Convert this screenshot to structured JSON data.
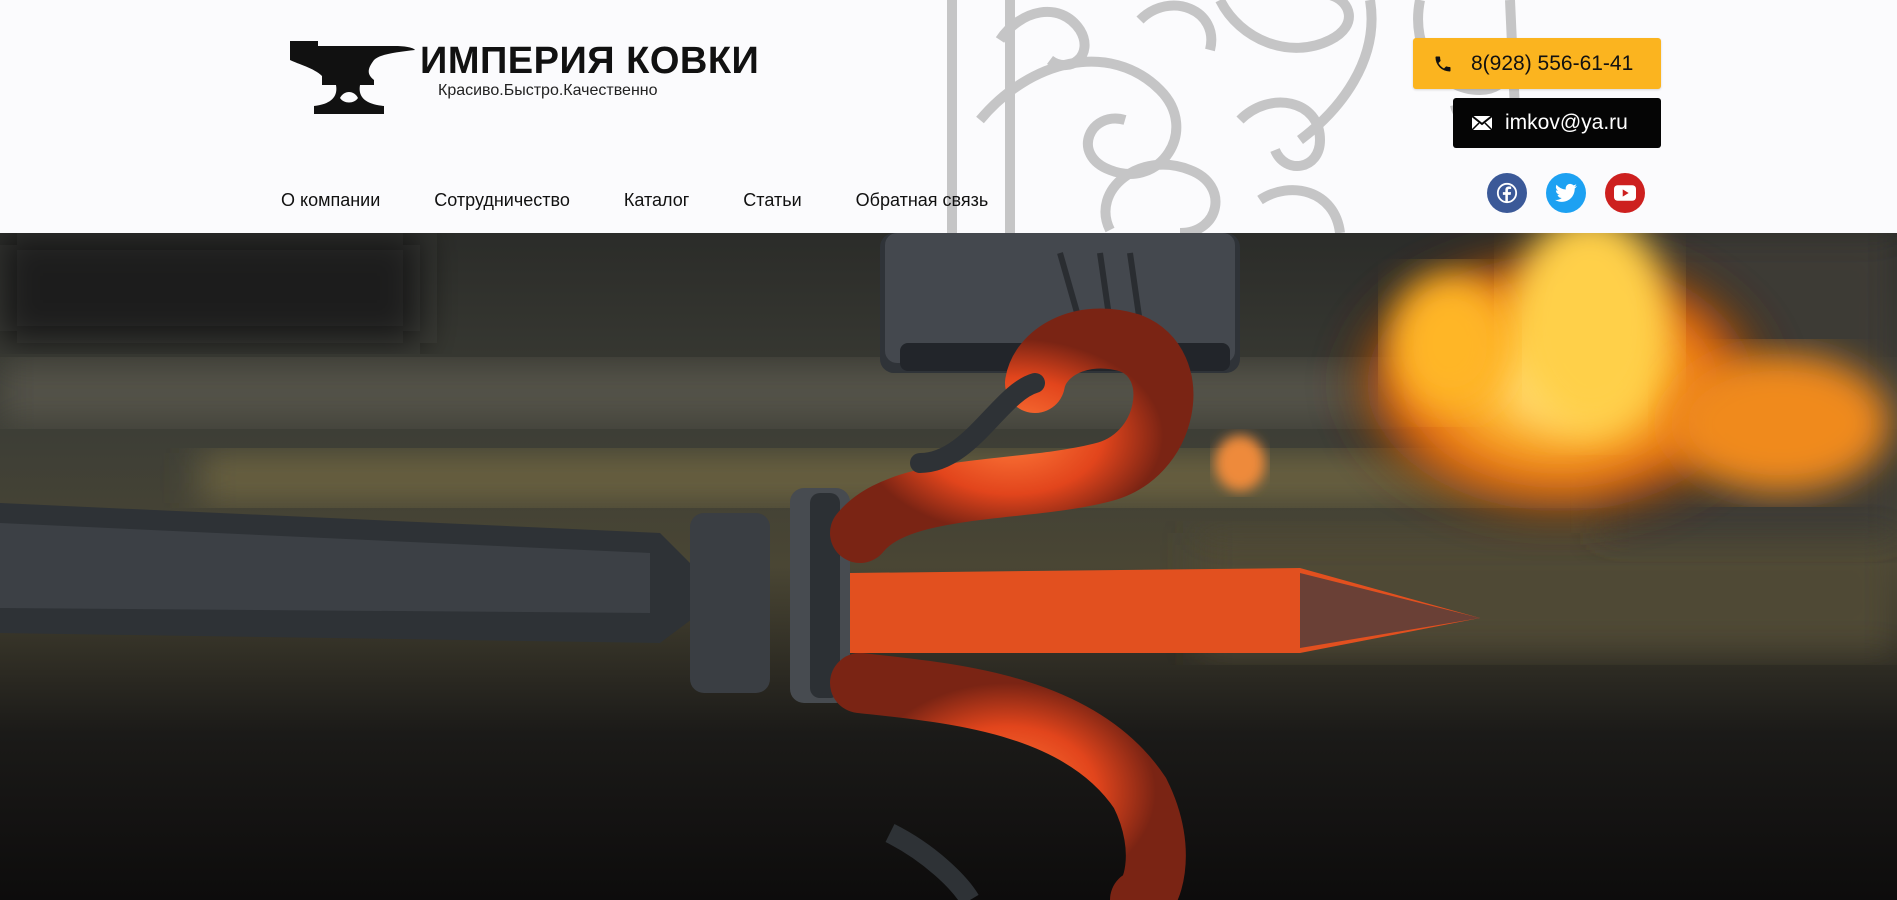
{
  "brand": {
    "title": "ИМПЕРИЯ КОВКИ",
    "tagline": "Красиво.Быстро.Качественно",
    "logo_icon": "anvil-icon"
  },
  "nav": {
    "items": [
      {
        "label": "О компании"
      },
      {
        "label": "Сотрудничество"
      },
      {
        "label": "Каталог"
      },
      {
        "label": "Статьи"
      },
      {
        "label": "Обратная связь"
      }
    ]
  },
  "contacts": {
    "phone": "8(928) 556-61-41",
    "email": "imkov@ya.ru",
    "phone_icon": "phone-icon",
    "email_icon": "envelope-icon"
  },
  "socials": [
    {
      "name": "facebook",
      "color": "#3b5998"
    },
    {
      "name": "twitter",
      "color": "#1da1f2"
    },
    {
      "name": "youtube",
      "color": "#cd201f"
    }
  ],
  "colors": {
    "accent": "#fbb41f",
    "dark_button": "#050505",
    "header_bg": "#fbfbfd"
  }
}
